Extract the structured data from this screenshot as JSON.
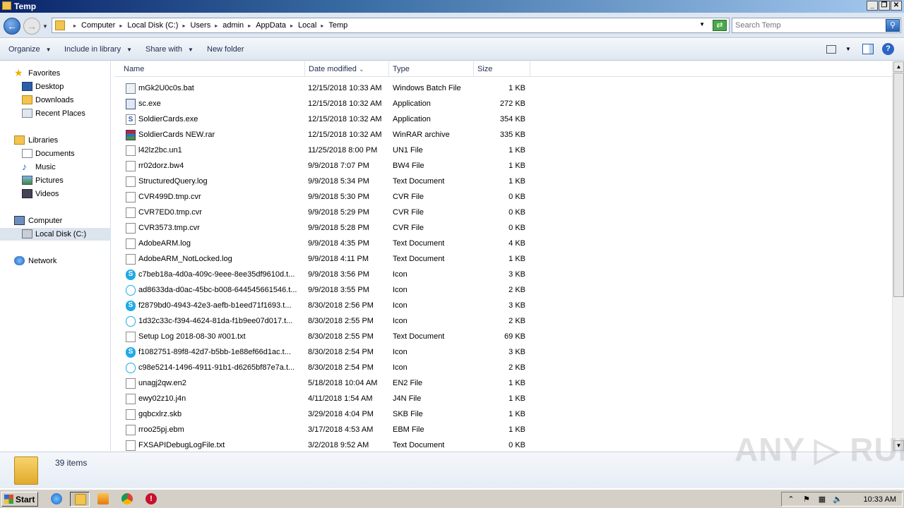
{
  "window": {
    "title": "Temp",
    "controls": {
      "minimize": "_",
      "maximize": "❐",
      "close": "✕"
    }
  },
  "address_bar": {
    "breadcrumbs": [
      "Computer",
      "Local Disk (C:)",
      "Users",
      "admin",
      "AppData",
      "Local",
      "Temp"
    ],
    "search_placeholder": "Search Temp"
  },
  "toolbar": {
    "organize": "Organize",
    "include_in_library": "Include in library",
    "share_with": "Share with",
    "new_folder": "New folder",
    "help": "?"
  },
  "nav_pane": {
    "favorites": {
      "label": "Favorites",
      "items": [
        "Desktop",
        "Downloads",
        "Recent Places"
      ]
    },
    "libraries": {
      "label": "Libraries",
      "items": [
        "Documents",
        "Music",
        "Pictures",
        "Videos"
      ]
    },
    "computer": {
      "label": "Computer",
      "items": [
        "Local Disk (C:)"
      ]
    },
    "network": {
      "label": "Network"
    },
    "selected": "Local Disk (C:)"
  },
  "columns": {
    "name": "Name",
    "date": "Date modified",
    "type": "Type",
    "size": "Size",
    "sort_indicator": "⌄"
  },
  "files": [
    {
      "name": "mGk2U0c0s.bat",
      "date": "12/15/2018 10:33 AM",
      "type": "Windows Batch File",
      "size": "1 KB",
      "icon": "batch-file-icon"
    },
    {
      "name": "sc.exe",
      "date": "12/15/2018 10:32 AM",
      "type": "Application",
      "size": "272 KB",
      "icon": "exe-icon"
    },
    {
      "name": "SoldierCards.exe",
      "date": "12/15/2018 10:32 AM",
      "type": "Application",
      "size": "354 KB",
      "icon": "app-icon"
    },
    {
      "name": "SoldierCards NEW.rar",
      "date": "12/15/2018 10:32 AM",
      "type": "WinRAR archive",
      "size": "335 KB",
      "icon": "winrar-icon"
    },
    {
      "name": "l42lz2bc.un1",
      "date": "11/25/2018 8:00 PM",
      "type": "UN1 File",
      "size": "1 KB",
      "icon": "file-icon"
    },
    {
      "name": "rr02dorz.bw4",
      "date": "9/9/2018 7:07 PM",
      "type": "BW4 File",
      "size": "1 KB",
      "icon": "file-icon"
    },
    {
      "name": "StructuredQuery.log",
      "date": "9/9/2018 5:34 PM",
      "type": "Text Document",
      "size": "1 KB",
      "icon": "text-file-icon"
    },
    {
      "name": "CVR499D.tmp.cvr",
      "date": "9/9/2018 5:30 PM",
      "type": "CVR File",
      "size": "0 KB",
      "icon": "file-icon"
    },
    {
      "name": "CVR7ED0.tmp.cvr",
      "date": "9/9/2018 5:29 PM",
      "type": "CVR File",
      "size": "0 KB",
      "icon": "file-icon"
    },
    {
      "name": "CVR3573.tmp.cvr",
      "date": "9/9/2018 5:28 PM",
      "type": "CVR File",
      "size": "0 KB",
      "icon": "file-icon"
    },
    {
      "name": "AdobeARM.log",
      "date": "9/9/2018 4:35 PM",
      "type": "Text Document",
      "size": "4 KB",
      "icon": "text-file-icon"
    },
    {
      "name": "AdobeARM_NotLocked.log",
      "date": "9/9/2018 4:11 PM",
      "type": "Text Document",
      "size": "1 KB",
      "icon": "text-file-icon"
    },
    {
      "name": "c7beb18a-4d0a-409c-9eee-8ee35df9610d.t...",
      "date": "9/9/2018 3:56 PM",
      "type": "Icon",
      "size": "3 KB",
      "icon": "skype-icon"
    },
    {
      "name": "ad8633da-d0ac-45bc-b008-644545661546.t...",
      "date": "9/9/2018 3:55 PM",
      "type": "Icon",
      "size": "2 KB",
      "icon": "skype-outline-icon"
    },
    {
      "name": "f2879bd0-4943-42e3-aefb-b1eed71f1693.t...",
      "date": "8/30/2018 2:56 PM",
      "type": "Icon",
      "size": "3 KB",
      "icon": "skype-icon"
    },
    {
      "name": "1d32c33c-f394-4624-81da-f1b9ee07d017.t...",
      "date": "8/30/2018 2:55 PM",
      "type": "Icon",
      "size": "2 KB",
      "icon": "skype-outline-icon"
    },
    {
      "name": "Setup Log 2018-08-30 #001.txt",
      "date": "8/30/2018 2:55 PM",
      "type": "Text Document",
      "size": "69 KB",
      "icon": "text-file-icon"
    },
    {
      "name": "f1082751-89f8-42d7-b5bb-1e88ef66d1ac.t...",
      "date": "8/30/2018 2:54 PM",
      "type": "Icon",
      "size": "3 KB",
      "icon": "skype-icon"
    },
    {
      "name": "c98e5214-1496-4911-91b1-d6265bf87e7a.t...",
      "date": "8/30/2018 2:54 PM",
      "type": "Icon",
      "size": "2 KB",
      "icon": "skype-outline-icon"
    },
    {
      "name": "unagj2qw.en2",
      "date": "5/18/2018 10:04 AM",
      "type": "EN2 File",
      "size": "1 KB",
      "icon": "file-icon"
    },
    {
      "name": "ewy02z10.j4n",
      "date": "4/11/2018 1:54 AM",
      "type": "J4N File",
      "size": "1 KB",
      "icon": "file-icon"
    },
    {
      "name": "gqbcxlrz.skb",
      "date": "3/29/2018 4:04 PM",
      "type": "SKB File",
      "size": "1 KB",
      "icon": "file-icon"
    },
    {
      "name": "rroo25pj.ebm",
      "date": "3/17/2018 4:53 AM",
      "type": "EBM File",
      "size": "1 KB",
      "icon": "file-icon"
    },
    {
      "name": "FXSAPIDebugLogFile.txt",
      "date": "3/2/2018 9:52 AM",
      "type": "Text Document",
      "size": "0 KB",
      "icon": "text-file-icon"
    }
  ],
  "details_pane": {
    "item_count": "39 items"
  },
  "watermark": "ANY ▷ RUN",
  "taskbar": {
    "start": "Start",
    "clock": "10:33 AM"
  }
}
